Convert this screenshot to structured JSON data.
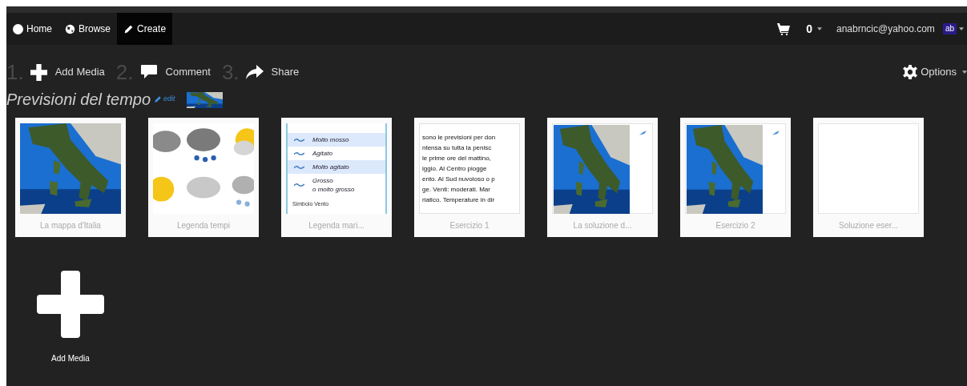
{
  "nav": [
    {
      "label": "Home",
      "kind": "logo",
      "selected": false
    },
    {
      "label": "Browse",
      "kind": "globe",
      "selected": false
    },
    {
      "label": "Create",
      "kind": "pencil",
      "selected": true
    }
  ],
  "account": {
    "cart_count": "0",
    "email": "anabrncic@yahoo.com",
    "avatar": "ab"
  },
  "steps": [
    {
      "number": "1.",
      "label": "Add Media",
      "kind": "plus"
    },
    {
      "number": "2.",
      "label": "Comment",
      "kind": "comment"
    },
    {
      "number": "3.",
      "label": "Share",
      "kind": "share"
    }
  ],
  "options": "Options",
  "title": "Previsioni del tempo",
  "edit_link": "edit",
  "media": [
    {
      "caption": "La mappa d'Italia",
      "kind": "map",
      "marked": false
    },
    {
      "caption": "Legenda tempi",
      "kind": "weather",
      "marked": false
    },
    {
      "caption": "Legenda mari...",
      "kind": "legend",
      "rows": [
        "Molto mosso",
        "Agitato",
        "Molto agitato",
        "Grosso\no molto grosso"
      ],
      "footer": "Simbolo Vento"
    },
    {
      "caption": "Esercizio 1",
      "kind": "document",
      "lines": [
        "sono le previsioni per don",
        "ntensa su tutta la penisc",
        "le prime ore del mattino,",
        "iggio. Al Centro piogge",
        "ento. Al Sud nuvoloso o p",
        "ge. Venti: moderati. Mar",
        "riatico. Temperature in dir"
      ]
    },
    {
      "caption": "La soluzione d...",
      "kind": "map",
      "marked": true
    },
    {
      "caption": "Esercizio 2",
      "kind": "map",
      "marked": true
    },
    {
      "caption": "Soluzione eser...",
      "kind": "blank"
    }
  ],
  "add_media": "Add Media"
}
